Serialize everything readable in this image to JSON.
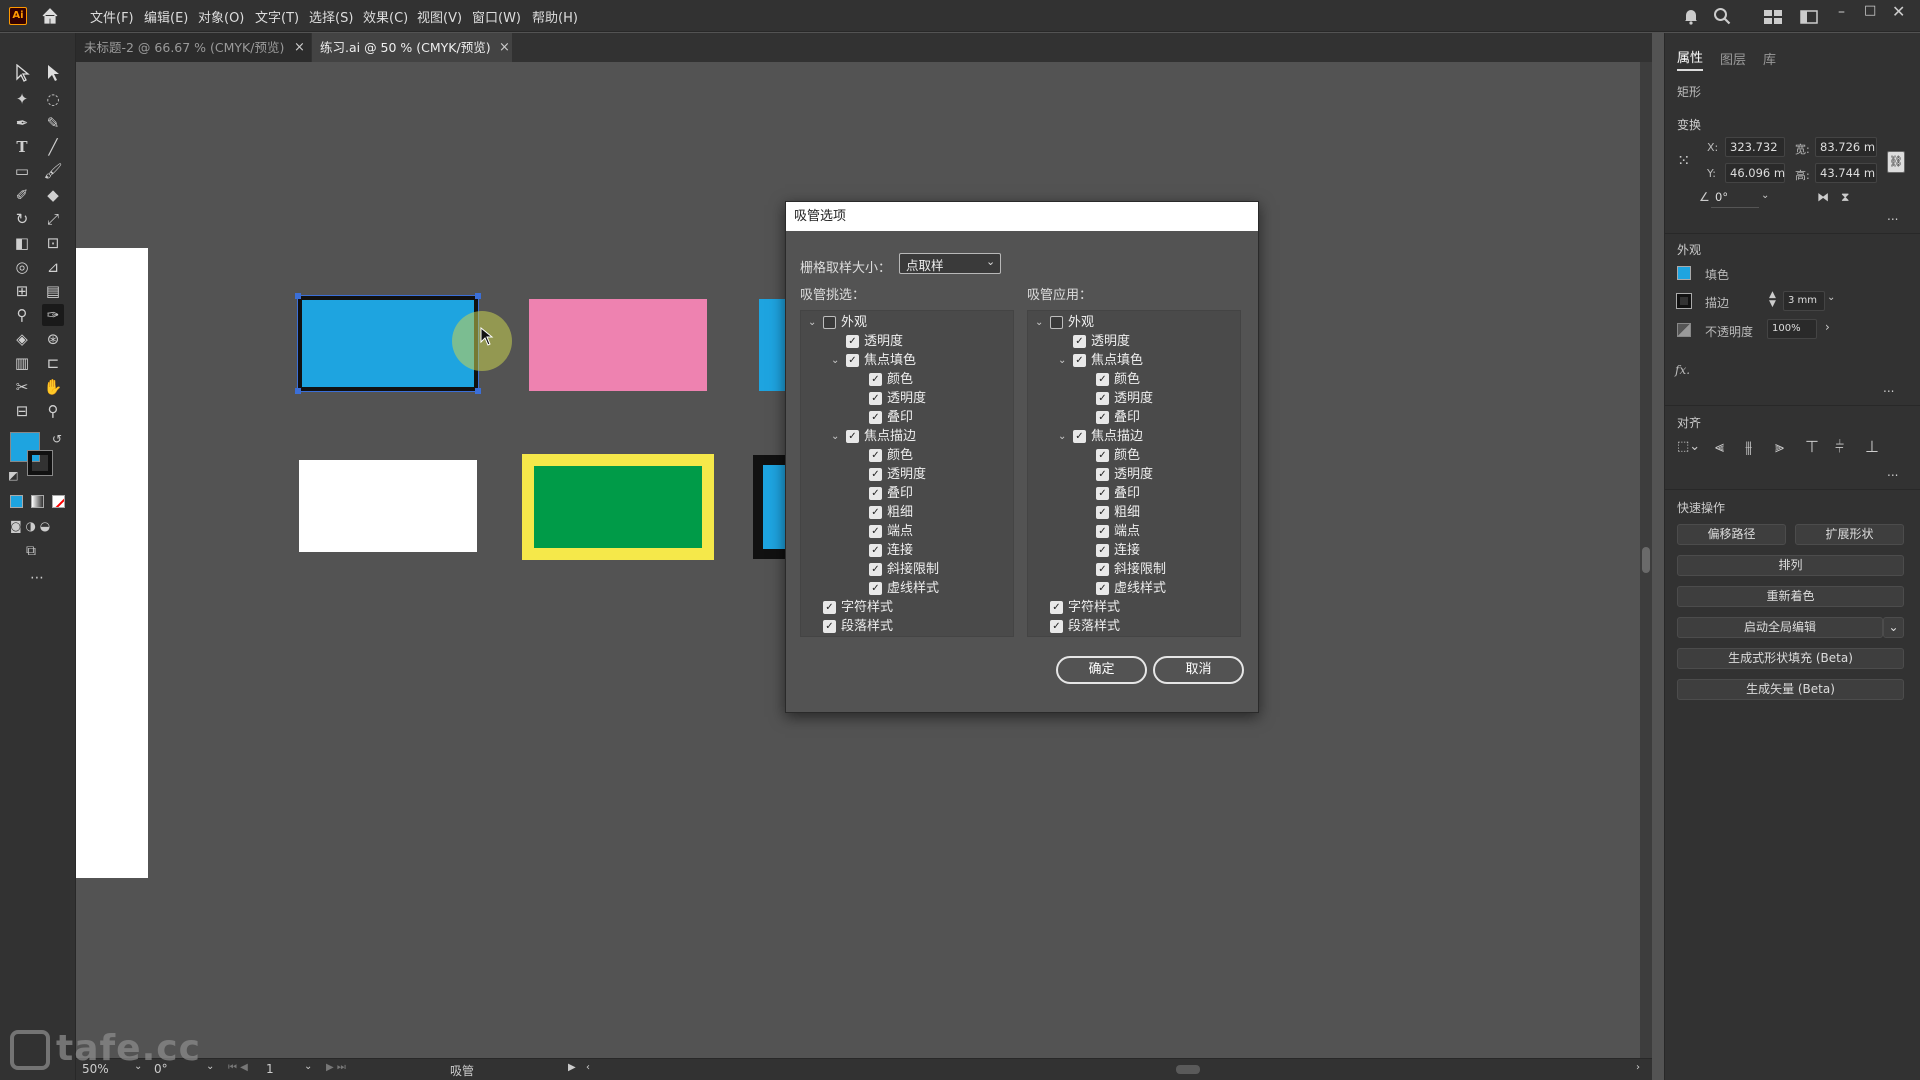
{
  "app": {
    "logo": "Ai",
    "home_icon": "home-icon"
  },
  "menu": [
    "文件(F)",
    "编辑(E)",
    "对象(O)",
    "文字(T)",
    "选择(S)",
    "效果(C)",
    "视图(V)",
    "窗口(W)",
    "帮助(H)"
  ],
  "tabs": [
    {
      "label": "未标题-2 @ 66.67 % (CMYK/预览)",
      "close": "×",
      "active": false
    },
    {
      "label": "练习.ai @ 50 % (CMYK/预览)",
      "close": "×",
      "active": true
    }
  ],
  "right_panel": {
    "tabs": [
      "属性",
      "图层",
      "库"
    ],
    "object_type": "矩形",
    "transform": {
      "heading": "变换",
      "x_label": "X:",
      "x_value": "323.732",
      "y_label": "Y:",
      "y_value": "46.096 m",
      "w_label": "宽:",
      "w_value": "83.726 m",
      "h_label": "高:",
      "h_value": "43.744 m",
      "angle_value": "0°"
    },
    "appearance": {
      "heading": "外观",
      "fill_label": "填色",
      "fill_color": "#1ea4e0",
      "stroke_label": "描边",
      "stroke_value": "3 mm",
      "opacity_label": "不透明度",
      "opacity_value": "100%",
      "fx": "fx."
    },
    "align": {
      "heading": "对齐"
    },
    "quick_actions": {
      "heading": "快速操作",
      "buttons": [
        "偏移路径",
        "扩展形状",
        "排列",
        "重新着色",
        "启动全局编辑",
        "生成式形状填充 (Beta)",
        "生成矢量 (Beta)"
      ]
    },
    "more": "..."
  },
  "status": {
    "zoom": "50%",
    "angle": "0°",
    "page": "1",
    "tool_name": "吸管"
  },
  "watermark": "tafe.cc",
  "colors": {
    "cyan": "#1ea4e0",
    "pink": "#ee82b0",
    "green": "#009b48",
    "yellow": "#f5e84a"
  },
  "dialog": {
    "title": "吸管选项",
    "raster_label": "栅格取样大小：",
    "raster_value": "点取样",
    "pick_heading": "吸管挑选：",
    "apply_heading": "吸管应用：",
    "pick_items": [
      {
        "label": "外观",
        "level": 0,
        "checked": false,
        "expand": true
      },
      {
        "label": "透明度",
        "level": 1,
        "checked": true,
        "expand": false
      },
      {
        "label": "焦点填色",
        "level": 1,
        "checked": true,
        "expand": true
      },
      {
        "label": "颜色",
        "level": 2,
        "checked": true,
        "expand": false
      },
      {
        "label": "透明度",
        "level": 2,
        "checked": true,
        "expand": false
      },
      {
        "label": "叠印",
        "level": 2,
        "checked": true,
        "expand": false
      },
      {
        "label": "焦点描边",
        "level": 1,
        "checked": true,
        "expand": true
      },
      {
        "label": "颜色",
        "level": 2,
        "checked": true,
        "expand": false
      },
      {
        "label": "透明度",
        "level": 2,
        "checked": true,
        "expand": false
      },
      {
        "label": "叠印",
        "level": 2,
        "checked": true,
        "expand": false
      },
      {
        "label": "粗细",
        "level": 2,
        "checked": true,
        "expand": false
      },
      {
        "label": "端点",
        "level": 2,
        "checked": true,
        "expand": false
      },
      {
        "label": "连接",
        "level": 2,
        "checked": true,
        "expand": false
      },
      {
        "label": "斜接限制",
        "level": 2,
        "checked": true,
        "expand": false
      },
      {
        "label": "虚线样式",
        "level": 2,
        "checked": true,
        "expand": false
      },
      {
        "label": "字符样式",
        "level": 0,
        "checked": true,
        "expand": false
      },
      {
        "label": "段落样式",
        "level": 0,
        "checked": true,
        "expand": false
      }
    ],
    "apply_items": [
      {
        "label": "外观",
        "level": 0,
        "checked": false,
        "expand": true
      },
      {
        "label": "透明度",
        "level": 1,
        "checked": true,
        "expand": false
      },
      {
        "label": "焦点填色",
        "level": 1,
        "checked": true,
        "expand": true
      },
      {
        "label": "颜色",
        "level": 2,
        "checked": true,
        "expand": false
      },
      {
        "label": "透明度",
        "level": 2,
        "checked": true,
        "expand": false
      },
      {
        "label": "叠印",
        "level": 2,
        "checked": true,
        "expand": false
      },
      {
        "label": "焦点描边",
        "level": 1,
        "checked": true,
        "expand": true
      },
      {
        "label": "颜色",
        "level": 2,
        "checked": true,
        "expand": false
      },
      {
        "label": "透明度",
        "level": 2,
        "checked": true,
        "expand": false
      },
      {
        "label": "叠印",
        "level": 2,
        "checked": true,
        "expand": false
      },
      {
        "label": "粗细",
        "level": 2,
        "checked": true,
        "expand": false
      },
      {
        "label": "端点",
        "level": 2,
        "checked": true,
        "expand": false
      },
      {
        "label": "连接",
        "level": 2,
        "checked": true,
        "expand": false
      },
      {
        "label": "斜接限制",
        "level": 2,
        "checked": true,
        "expand": false
      },
      {
        "label": "虚线样式",
        "level": 2,
        "checked": true,
        "expand": false
      },
      {
        "label": "字符样式",
        "level": 0,
        "checked": true,
        "expand": false
      },
      {
        "label": "段落样式",
        "level": 0,
        "checked": true,
        "expand": false
      }
    ],
    "ok_label": "确定",
    "cancel_label": "取消"
  }
}
